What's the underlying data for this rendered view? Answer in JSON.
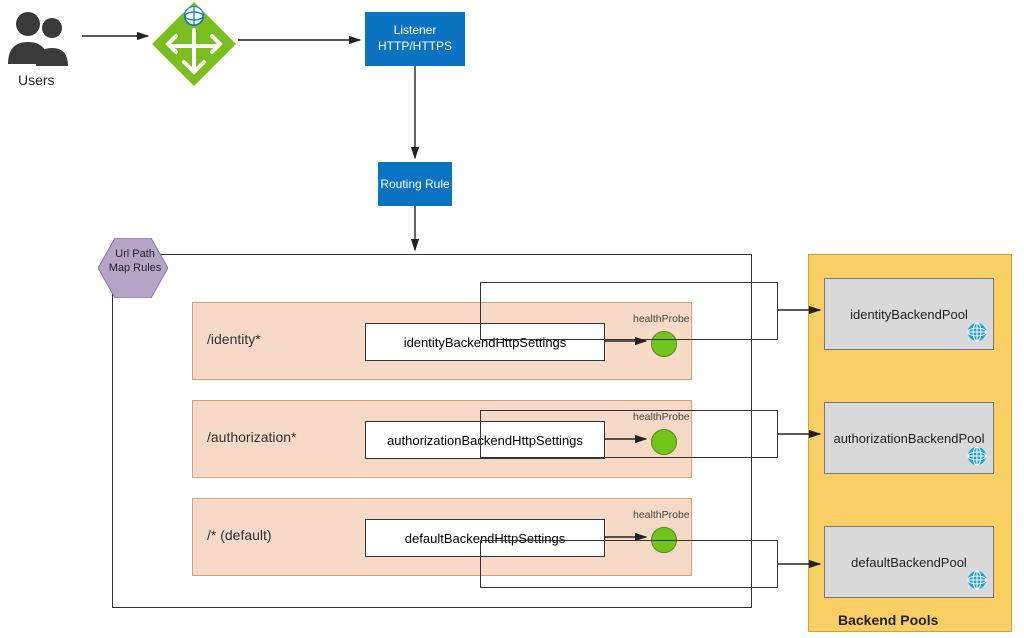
{
  "users": {
    "label": "Users"
  },
  "listener": {
    "line1": "Listener",
    "line2": "HTTP/HTTPS"
  },
  "routing": {
    "label": "Routing Rule"
  },
  "urlPath": {
    "label": "Url Path Map Rules"
  },
  "rules": [
    {
      "path": "/identity*",
      "settings": "identityBackendHttpSettings",
      "probe": "healthProbe"
    },
    {
      "path": "/authorization*",
      "settings": "authorizationBackendHttpSettings",
      "probe": "healthProbe"
    },
    {
      "path": "/* (default)",
      "settings": "defaultBackendHttpSettings",
      "probe": "healthProbe"
    }
  ],
  "pools": {
    "title": "Backend Pools",
    "items": [
      {
        "name": "identityBackendPool"
      },
      {
        "name": "authorizationBackendPool"
      },
      {
        "name": "defaultBackendPool"
      }
    ]
  }
}
